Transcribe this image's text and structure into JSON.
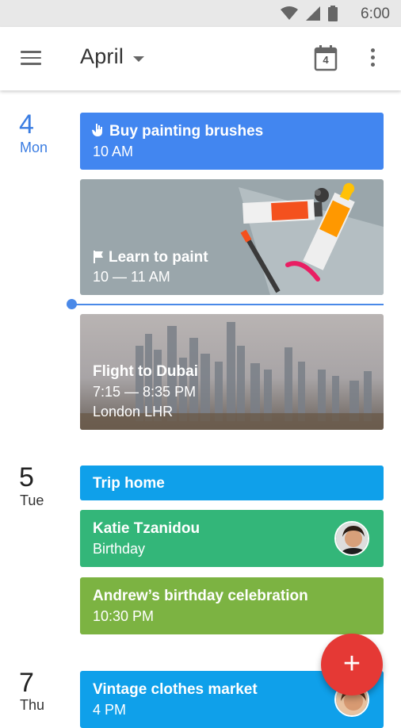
{
  "status_bar": {
    "time": "6:00",
    "icons": [
      "wifi-icon",
      "signal-icon",
      "battery-icon"
    ]
  },
  "app_bar": {
    "title": "April",
    "today_badge": "4"
  },
  "days": [
    {
      "number": "4",
      "name": "Mon",
      "events": [
        {
          "title": "Buy painting brushes",
          "subtitle": "10 AM",
          "color": "#4286f0"
        },
        {
          "title": "Learn to paint",
          "subtitle": "10 — 11 AM"
        },
        {
          "title": "Flight to Dubai",
          "subtitle": "7:15 — 8:35 PM",
          "subtitle2": "London LHR"
        }
      ]
    },
    {
      "number": "5",
      "name": "Tue",
      "events": [
        {
          "title": "Trip home",
          "color": "#0fa0ea"
        },
        {
          "title": "Katie Tzanidou",
          "subtitle": "Birthday",
          "color": "#33b679"
        },
        {
          "title": "Andrew’s birthday celebration",
          "subtitle": "10:30 PM",
          "color": "#7cb342"
        }
      ]
    },
    {
      "number": "7",
      "name": "Thu",
      "events": [
        {
          "title": "Vintage clothes market",
          "subtitle": "4 PM",
          "color": "#0fa0ea"
        }
      ]
    }
  ],
  "fab": {
    "label": "+"
  },
  "colors": {
    "accent": "#3b7de2",
    "fab": "#e53935"
  }
}
